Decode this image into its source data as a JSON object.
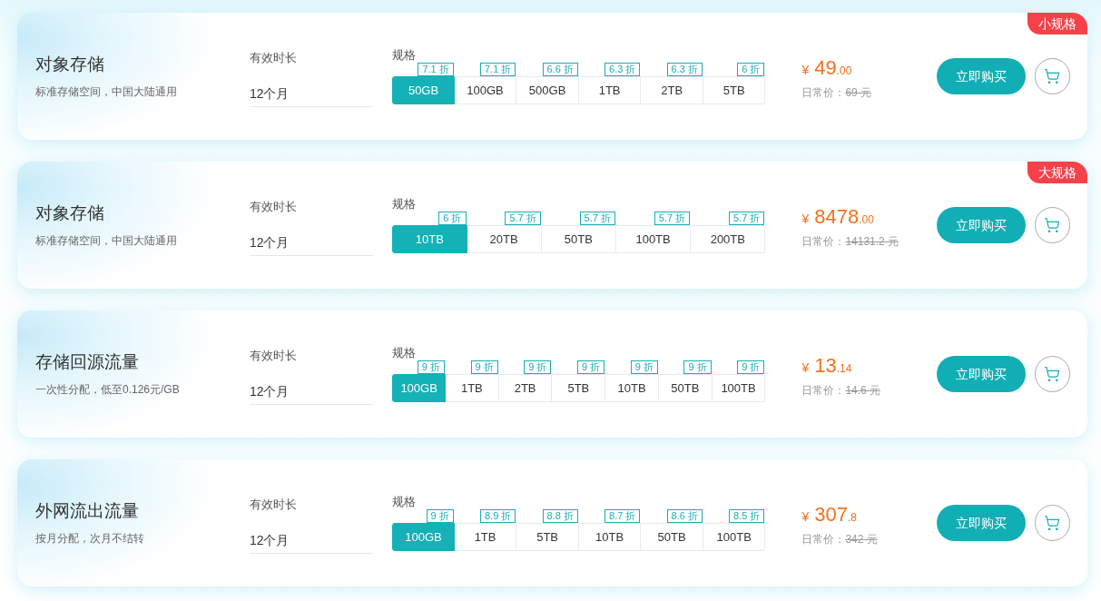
{
  "products": [
    {
      "title": "对象存储",
      "subtitle": "标准存储空间，中国大陆通用",
      "badge": "小规格",
      "duration": {
        "label": "有效时长",
        "value": "12个月"
      },
      "spec": {
        "label": "规格",
        "options": [
          {
            "label": "50GB",
            "discount": "7.1 折",
            "selected": true
          },
          {
            "label": "100GB",
            "discount": "7.1 折",
            "selected": false
          },
          {
            "label": "500GB",
            "discount": "6.6 折",
            "selected": false
          },
          {
            "label": "1TB",
            "discount": "6.3 折",
            "selected": false
          },
          {
            "label": "2TB",
            "discount": "6.3 折",
            "selected": false
          },
          {
            "label": "5TB",
            "discount": "6 折",
            "selected": false
          }
        ]
      },
      "price": {
        "currency": "¥",
        "integer": "49",
        "decimal": ".00"
      },
      "regular_price": {
        "label": "日常价：",
        "value": "69 元"
      },
      "buy_button": "立即购买"
    },
    {
      "title": "对象存储",
      "subtitle": "标准存储空间，中国大陆通用",
      "badge": "大规格",
      "duration": {
        "label": "有效时长",
        "value": "12个月"
      },
      "spec": {
        "label": "规格",
        "options": [
          {
            "label": "10TB",
            "discount": "6 折",
            "selected": true
          },
          {
            "label": "20TB",
            "discount": "5.7 折",
            "selected": false
          },
          {
            "label": "50TB",
            "discount": "5.7 折",
            "selected": false
          },
          {
            "label": "100TB",
            "discount": "5.7 折",
            "selected": false
          },
          {
            "label": "200TB",
            "discount": "5.7 折",
            "selected": false
          }
        ]
      },
      "price": {
        "currency": "¥",
        "integer": "8478",
        "decimal": ".00"
      },
      "regular_price": {
        "label": "日常价：",
        "value": "14131.2 元"
      },
      "buy_button": "立即购买"
    },
    {
      "title": "存储回源流量",
      "subtitle": "一次性分配，低至0.126元/GB",
      "duration": {
        "label": "有效时长",
        "value": "12个月"
      },
      "spec": {
        "label": "规格",
        "options": [
          {
            "label": "100GB",
            "discount": "9 折",
            "selected": true
          },
          {
            "label": "1TB",
            "discount": "9 折",
            "selected": false
          },
          {
            "label": "2TB",
            "discount": "9 折",
            "selected": false
          },
          {
            "label": "5TB",
            "discount": "9 折",
            "selected": false
          },
          {
            "label": "10TB",
            "discount": "9 折",
            "selected": false
          },
          {
            "label": "50TB",
            "discount": "9 折",
            "selected": false
          },
          {
            "label": "100TB",
            "discount": "9 折",
            "selected": false
          }
        ]
      },
      "price": {
        "currency": "¥",
        "integer": "13",
        "decimal": ".14"
      },
      "regular_price": {
        "label": "日常价：",
        "value": "14.6 元"
      },
      "buy_button": "立即购买"
    },
    {
      "title": "外网流出流量",
      "subtitle": "按月分配，次月不结转",
      "duration": {
        "label": "有效时长",
        "value": "12个月"
      },
      "spec": {
        "label": "规格",
        "options": [
          {
            "label": "100GB",
            "discount": "9 折",
            "selected": true
          },
          {
            "label": "1TB",
            "discount": "8.9 折",
            "selected": false
          },
          {
            "label": "5TB",
            "discount": "8.8 折",
            "selected": false
          },
          {
            "label": "10TB",
            "discount": "8.7 折",
            "selected": false
          },
          {
            "label": "50TB",
            "discount": "8.6 折",
            "selected": false
          },
          {
            "label": "100TB",
            "discount": "8.5 折",
            "selected": false
          }
        ]
      },
      "price": {
        "currency": "¥",
        "integer": "307",
        "decimal": ".8"
      },
      "regular_price": {
        "label": "日常价：",
        "value": "342 元"
      },
      "buy_button": "立即购买"
    }
  ]
}
